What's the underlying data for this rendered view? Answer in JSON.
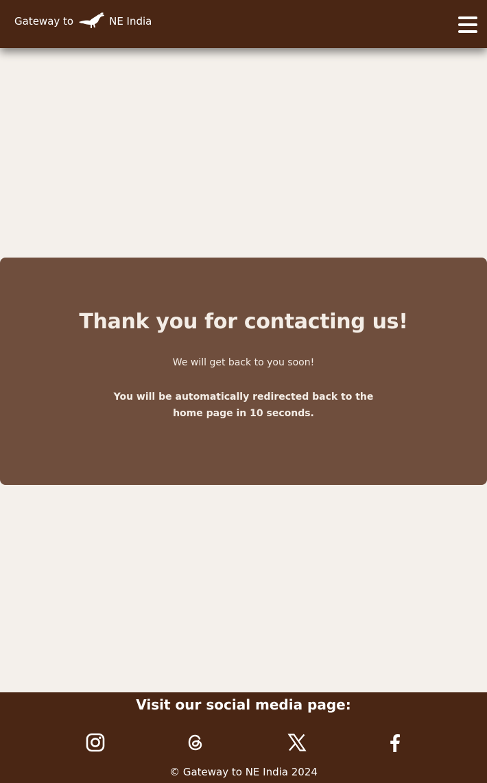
{
  "header": {
    "logo_prefix": "Gateway to",
    "logo_suffix": "NE India",
    "logo_icon": "hornbill-bird-icon",
    "menu_icon": "hamburger-menu-icon"
  },
  "message": {
    "title": "Thank you for contacting us!",
    "subtitle": "We will get back to you soon!",
    "redirect_text": "You will be automatically redirected back to the home page in 10 seconds."
  },
  "footer": {
    "heading": "Visit our social media page:",
    "social_icons": [
      "instagram-icon",
      "threads-icon",
      "x-icon",
      "facebook-icon"
    ],
    "copyright": "© Gateway to NE India 2024"
  },
  "colors": {
    "header_bg": "#4a2614",
    "page_bg": "#f4f0eb",
    "card_bg": "#6f4e3d",
    "footer_bg": "#4a2614",
    "text_light": "#f4ede6"
  }
}
